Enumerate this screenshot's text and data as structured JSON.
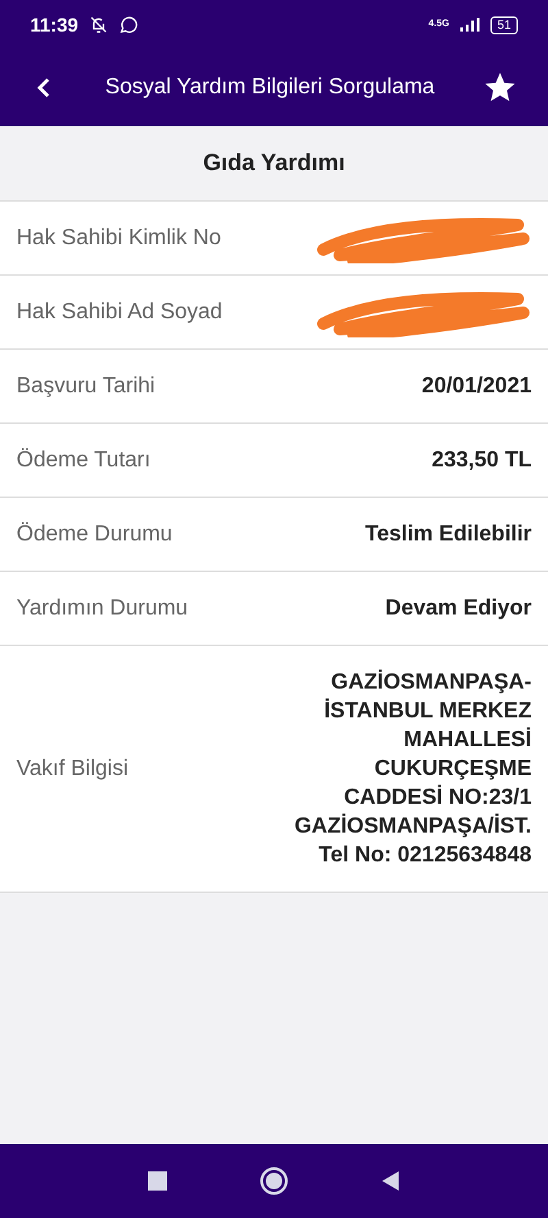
{
  "status_bar": {
    "time": "11:39",
    "network": "4.5G",
    "battery": "51"
  },
  "header": {
    "title": "Sosyal Yardım Bilgileri Sorgulama"
  },
  "section_title": "Gıda Yardımı",
  "rows": [
    {
      "kind": "redacted",
      "label": "Hak Sahibi Kimlik No"
    },
    {
      "kind": "redacted",
      "label": "Hak Sahibi Ad Soyad"
    },
    {
      "kind": "text",
      "label": "Başvuru Tarihi",
      "value_lines": [
        "20/01/2021"
      ]
    },
    {
      "kind": "text",
      "label": "Ödeme Tutarı",
      "value_lines": [
        "233,50 TL"
      ]
    },
    {
      "kind": "text",
      "label": "Ödeme Durumu",
      "value_lines": [
        "Teslim Edilebilir"
      ]
    },
    {
      "kind": "text",
      "label": "Yardımın Durumu",
      "value_lines": [
        "Devam Ediyor"
      ]
    },
    {
      "kind": "text",
      "label": "Vakıf Bilgisi",
      "value_lines": [
        "GAZİOSMANPAŞA-",
        "İSTANBUL MERKEZ",
        "MAHALLESİ",
        "CUKURÇEŞME",
        "CADDESİ NO:23/1",
        "GAZİOSMANPAŞA/İST.",
        "Tel No: 02125634848"
      ]
    }
  ]
}
